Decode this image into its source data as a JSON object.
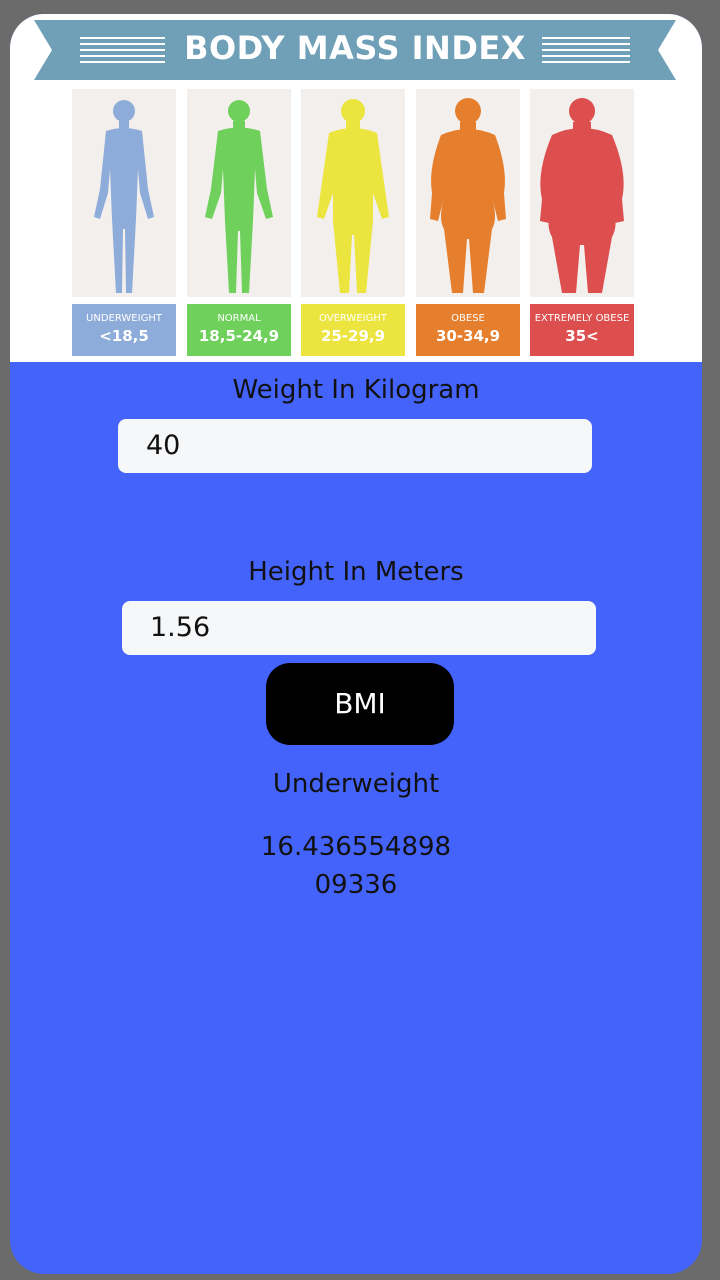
{
  "banner": {
    "title": "BODY MASS INDEX"
  },
  "categories": [
    {
      "name": "UNDERWEIGHT",
      "range": "<18,5",
      "figure_color": "#8eacd9",
      "label_bg": "#8eacd9"
    },
    {
      "name": "NORMAL",
      "range": "18,5-24,9",
      "figure_color": "#6fd15c",
      "label_bg": "#6fd15c"
    },
    {
      "name": "OVERWEIGHT",
      "range": "25-29,9",
      "figure_color": "#ece43f",
      "label_bg": "#ece43f"
    },
    {
      "name": "OBESE",
      "range": "30-34,9",
      "figure_color": "#e67f2d",
      "label_bg": "#e67f2d"
    },
    {
      "name": "EXTREMELY OBESE",
      "range": "35<",
      "figure_color": "#dd4e4e",
      "label_bg": "#dd4e4e"
    }
  ],
  "form": {
    "weight_label": "Weight In Kilogram",
    "weight_value": "40",
    "height_label": "Height In Meters",
    "height_value": "1.56",
    "button_label": "BMI"
  },
  "result": {
    "category": "Underweight",
    "value": "16.43655489809336"
  },
  "colors": {
    "background": "#4463fb",
    "frame": "#6b6b6b",
    "banner": "#6fa0b8",
    "button": "#000000"
  }
}
